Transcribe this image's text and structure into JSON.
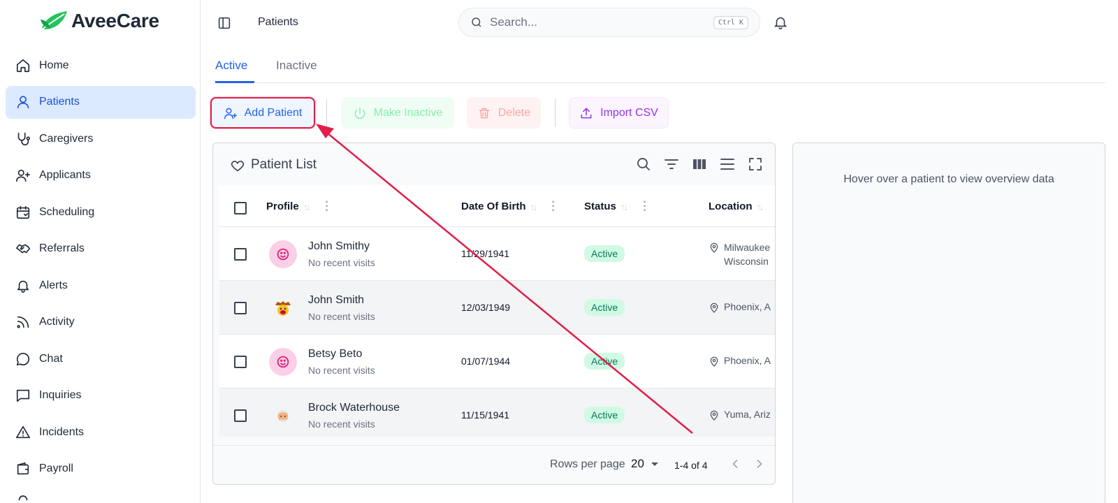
{
  "brand": {
    "name": "AveeCare",
    "accent": "#2563eb",
    "leaf_color": "#22c55e"
  },
  "sidebar": {
    "items": [
      {
        "label": "Home",
        "icon": "home-icon",
        "active": false
      },
      {
        "label": "Patients",
        "icon": "user-icon",
        "active": true
      },
      {
        "label": "Caregivers",
        "icon": "stethoscope-icon",
        "active": false
      },
      {
        "label": "Applicants",
        "icon": "user-plus-icon",
        "active": false
      },
      {
        "label": "Scheduling",
        "icon": "calendar-icon",
        "active": false
      },
      {
        "label": "Referrals",
        "icon": "handshake-icon",
        "active": false
      },
      {
        "label": "Alerts",
        "icon": "bell-icon",
        "active": false
      },
      {
        "label": "Activity",
        "icon": "rss-icon",
        "active": false
      },
      {
        "label": "Chat",
        "icon": "chat-bubble-icon",
        "active": false
      },
      {
        "label": "Inquiries",
        "icon": "message-square-icon",
        "active": false
      },
      {
        "label": "Incidents",
        "icon": "alert-triangle-icon",
        "active": false
      },
      {
        "label": "Payroll",
        "icon": "wallet-icon",
        "active": false
      }
    ]
  },
  "header": {
    "title": "Patients",
    "search_placeholder": "Search...",
    "search_shortcut": "Ctrl K"
  },
  "tabs": [
    {
      "label": "Active",
      "active": true
    },
    {
      "label": "Inactive",
      "active": false
    }
  ],
  "toolbar": {
    "add_label": "Add Patient",
    "make_inactive_label": "Make Inactive",
    "delete_label": "Delete",
    "import_label": "Import CSV"
  },
  "patient_list": {
    "title": "Patient List",
    "columns": [
      "Profile",
      "Date Of Birth",
      "Status",
      "Location"
    ],
    "rows": [
      {
        "name": "John Smithy",
        "sub": "No recent visits",
        "dob": "11/29/1941",
        "status": "Active",
        "location_line1": "Milwaukee",
        "location_line2": "Wisconsin",
        "avatar": "smiley-icon"
      },
      {
        "name": "John Smith",
        "sub": "No recent visits",
        "dob": "12/03/1949",
        "status": "Active",
        "location_line1": "Phoenix, A",
        "location_line2": "",
        "avatar": "cowboy-emoji-icon"
      },
      {
        "name": "Betsy Beto",
        "sub": "No recent visits",
        "dob": "01/07/1944",
        "status": "Active",
        "location_line1": "Phoenix, A",
        "location_line2": "",
        "avatar": "smiley-icon"
      },
      {
        "name": "Brock Waterhouse",
        "sub": "No recent visits",
        "dob": "11/15/1941",
        "status": "Active",
        "location_line1": "Yuma, Ariz",
        "location_line2": "",
        "avatar": "old-man-emoji-icon"
      }
    ],
    "footer": {
      "rows_per_page_label": "Rows per page",
      "rows_per_page_value": "20",
      "range": "1-4 of 4"
    }
  },
  "overview": {
    "placeholder": "Hover over a patient to view overview data"
  },
  "annotation": {
    "arrow_color": "#e11d48"
  }
}
